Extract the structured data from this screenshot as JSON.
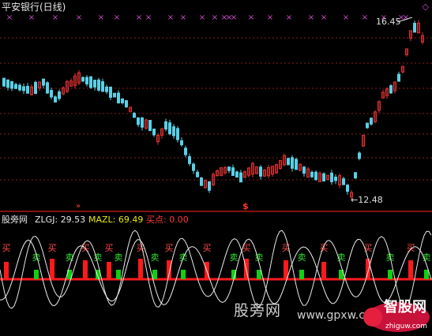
{
  "window": {
    "title": "平安银行(日线)",
    "top_right_icon": "diamond-icon",
    "top_right_glyph": "◇"
  },
  "price_panel": {
    "high_label": "16.45",
    "low_label": "←12.48",
    "dollar_mark": "$",
    "signal_mark": "»",
    "cross_glyph": "×"
  },
  "indicator_panel": {
    "name": "股旁网",
    "zlgj": "ZLGJ: 29.53",
    "mazl": "MAZL: 69.49",
    "buy_point": "买点: 0.00",
    "buy_text": "买",
    "sell_text": "卖"
  },
  "watermark": {
    "main": "股旁网",
    "url": "www.gpxw.com",
    "logo": "智股网",
    "logo_sub": "zhiguw.com"
  },
  "colors": {
    "background": "#000000",
    "grid": "#8a1b1b",
    "divider": "#b01818",
    "up_candle": "#e23030",
    "down_candle": "#5ad0e6",
    "cross": "#d04ad0",
    "zlgj_color": "#e8e8e8",
    "mazl_color": "#e6e600",
    "buy_point_color": "#ff3b3b",
    "buy_bar": "#ff1a1a",
    "sell_bar": "#10d010",
    "buy_text_color": "#ff4a4a",
    "sell_text_color": "#2ee02e"
  },
  "chart_data": [
    {
      "type": "candlestick",
      "title": "平安银行(日线)",
      "annotations": [
        "16.45",
        "←12.48"
      ],
      "high": 16.45,
      "low": 12.48,
      "grid": true
    },
    {
      "type": "bar",
      "title": "股旁网",
      "series": [
        {
          "name": "ZLGJ",
          "last_value": 29.53
        },
        {
          "name": "MAZL",
          "last_value": 69.49
        },
        {
          "name": "买点",
          "last_value": 0.0
        }
      ],
      "signals": [
        "买",
        "卖",
        "买",
        "卖",
        "买",
        "卖",
        "买",
        "卖",
        "买",
        "卖",
        "买",
        "卖",
        "买",
        "卖",
        "买",
        "卖",
        "买",
        "卖",
        "买",
        "卖",
        "买",
        "卖",
        "买",
        "卖"
      ]
    }
  ]
}
